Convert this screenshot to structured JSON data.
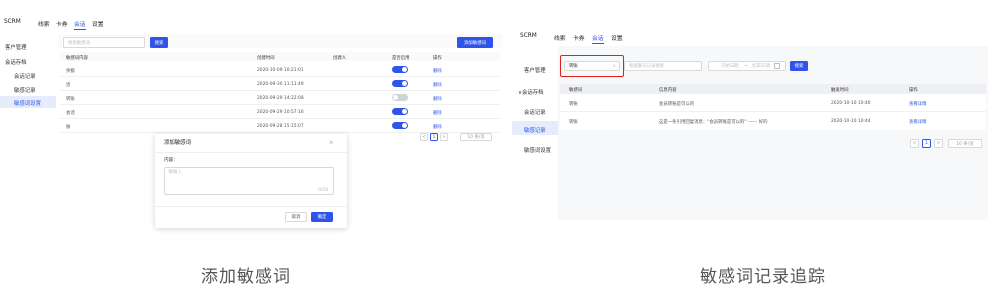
{
  "left": {
    "topnav": [
      "SCRM",
      "线索",
      "卡券",
      "会话",
      "设置"
    ],
    "active_nav_index": 3,
    "sidebar": {
      "items": [
        "客户管理",
        "会话存档",
        "会话记录",
        "敏感记录",
        "敏感词设置"
      ],
      "active_index": 4
    },
    "search_placeholder": "搜索敏感词",
    "search_button": "搜索",
    "add_button": "添加敏感词",
    "table": {
      "headers": [
        "敏感词内容",
        "创建时间",
        "创建人",
        "是否启用",
        "操作"
      ],
      "rows": [
        {
          "word": "余额",
          "time": "2020-10-09 10:21:01",
          "creator": "",
          "enabled": true,
          "action": "删除"
        },
        {
          "word": "话",
          "time": "2020-09-30 11:11:49",
          "creator": "",
          "enabled": true,
          "action": "删除"
        },
        {
          "word": "转账",
          "time": "2020-09-29 14:22:08",
          "creator": "",
          "enabled": false,
          "action": "删除"
        },
        {
          "word": "会话",
          "time": "2020-09-29 10:57:16",
          "creator": "",
          "enabled": true,
          "action": "删除"
        },
        {
          "word": "账",
          "time": "2020-09-28 15:15:07",
          "creator": "",
          "enabled": true,
          "action": "删除"
        }
      ]
    },
    "pager": {
      "prev": "<",
      "page": "1",
      "next": ">",
      "size": "10 条/页"
    },
    "dialog": {
      "title": "添加敏感词",
      "close": "×",
      "content_label": "内容：",
      "textarea_placeholder": "请输入",
      "counter": "0/50",
      "cancel": "取消",
      "confirm": "确定"
    },
    "caption": "添加敏感词"
  },
  "right": {
    "topnav": [
      "SCRM",
      "线索",
      "卡券",
      "会话",
      "设置"
    ],
    "active_nav_index": 3,
    "sidebar": {
      "items": [
        "客户管理",
        "∨会话存档",
        "会话记录",
        "敏感记录",
        "敏感词设置"
      ],
      "active_index": 3
    },
    "filter": {
      "select_value": "转账",
      "select_arrow": "∨",
      "search_placeholder": "根据聊天记录搜索",
      "date_start": "开始日期",
      "date_sep": "→",
      "date_end": "结束日期",
      "search_button": "搜索"
    },
    "table": {
      "headers": [
        "敏感词",
        "信息内容",
        "触发时间",
        "操作"
      ],
      "rows": [
        {
          "word": "转账",
          "content": "会员转账是可以的",
          "time": "2020-10-10 10:40",
          "action": "查看详情"
        },
        {
          "word": "转账",
          "content": "这是一条引用回复消息：\"会员转账是可以的\" ------ 好的",
          "time": "2020-10-10 10:44",
          "action": "查看详情"
        }
      ]
    },
    "pager": {
      "prev": "<",
      "page": "1",
      "next": ">",
      "size": "10 条/页"
    },
    "caption": "敏感词记录追踪"
  },
  "colors": {
    "accent": "#2f54eb",
    "highlight": "#e02020",
    "selected_bg": "#e6ecfb"
  }
}
